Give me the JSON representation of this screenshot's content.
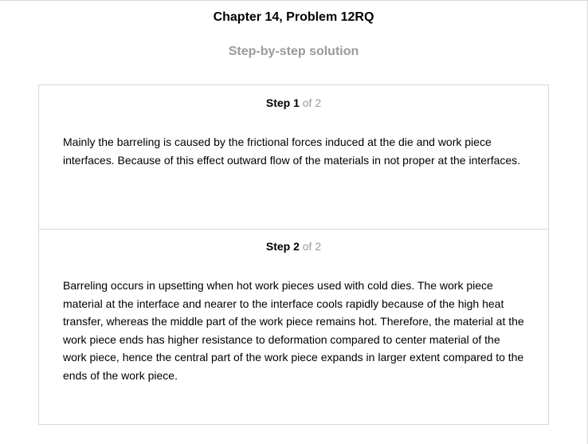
{
  "header": {
    "title": "Chapter 14, Problem 12RQ",
    "subtitle": "Step-by-step solution"
  },
  "steps": [
    {
      "label": "Step 1",
      "total": "of 2",
      "text": "Mainly the barreling is caused by the frictional forces induced at the die and work piece interfaces. Because of this effect outward flow of the materials in not proper at the interfaces."
    },
    {
      "label": "Step 2",
      "total": "of 2",
      "text": "Barreling occurs in upsetting when hot work pieces used with cold dies. The work piece material at the interface and nearer to the interface cools rapidly because of the high heat transfer, whereas the middle part of the work piece remains hot. Therefore, the material at the work piece ends has higher resistance to deformation compared to center material of the work piece, hence the central part of the work piece expands in larger extent compared to the ends of the work piece."
    }
  ]
}
